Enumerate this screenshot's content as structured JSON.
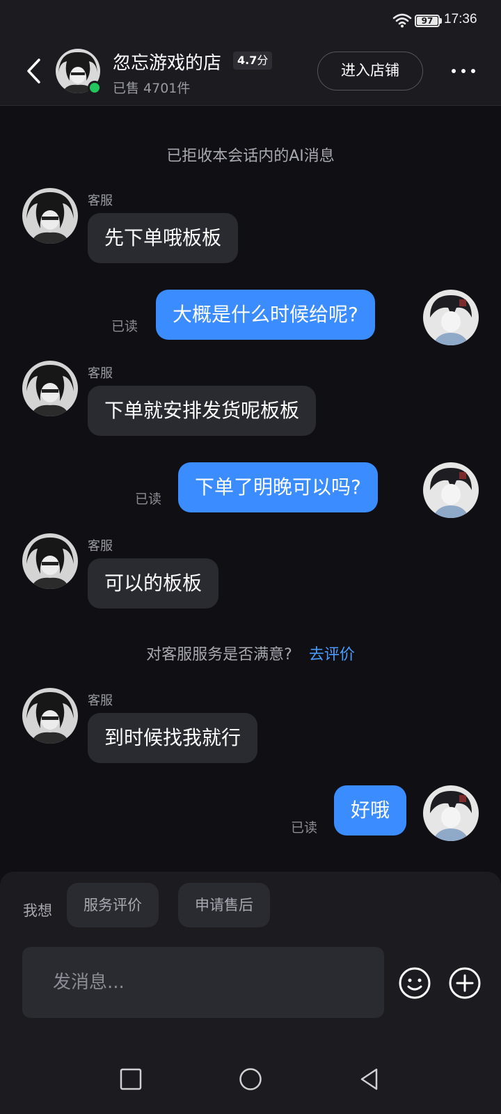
{
  "status_bar": {
    "time": "17:36",
    "battery": "97"
  },
  "header": {
    "shop_name": "忽忘游戏的店",
    "rating": "4.7",
    "rating_unit": "分",
    "sold": "已售 4701件",
    "enter_shop": "进入店铺"
  },
  "chat": {
    "ai_notice": "已拒收本会话内的AI消息",
    "messages": [
      {
        "from": "agent",
        "sender": "客服",
        "text": "先下单哦板板"
      },
      {
        "from": "me",
        "text": "大概是什么时候给呢?",
        "status": "已读"
      },
      {
        "from": "agent",
        "sender": "客服",
        "text": "下单就安排发货呢板板"
      },
      {
        "from": "me",
        "text": "下单了明晚可以吗?",
        "status": "已读"
      },
      {
        "from": "agent",
        "sender": "客服",
        "text": "可以的板板"
      },
      {
        "from": "agent",
        "sender": "客服",
        "text": "到时候找我就行"
      },
      {
        "from": "me",
        "text": "好哦",
        "status": "已读"
      }
    ],
    "satisfaction": {
      "question": "对客服服务是否满意?",
      "link": "去评价"
    }
  },
  "bottom": {
    "want_label": "我想",
    "quick_actions": [
      "服务评价",
      "申请售后"
    ],
    "input_placeholder": "发消息..."
  }
}
